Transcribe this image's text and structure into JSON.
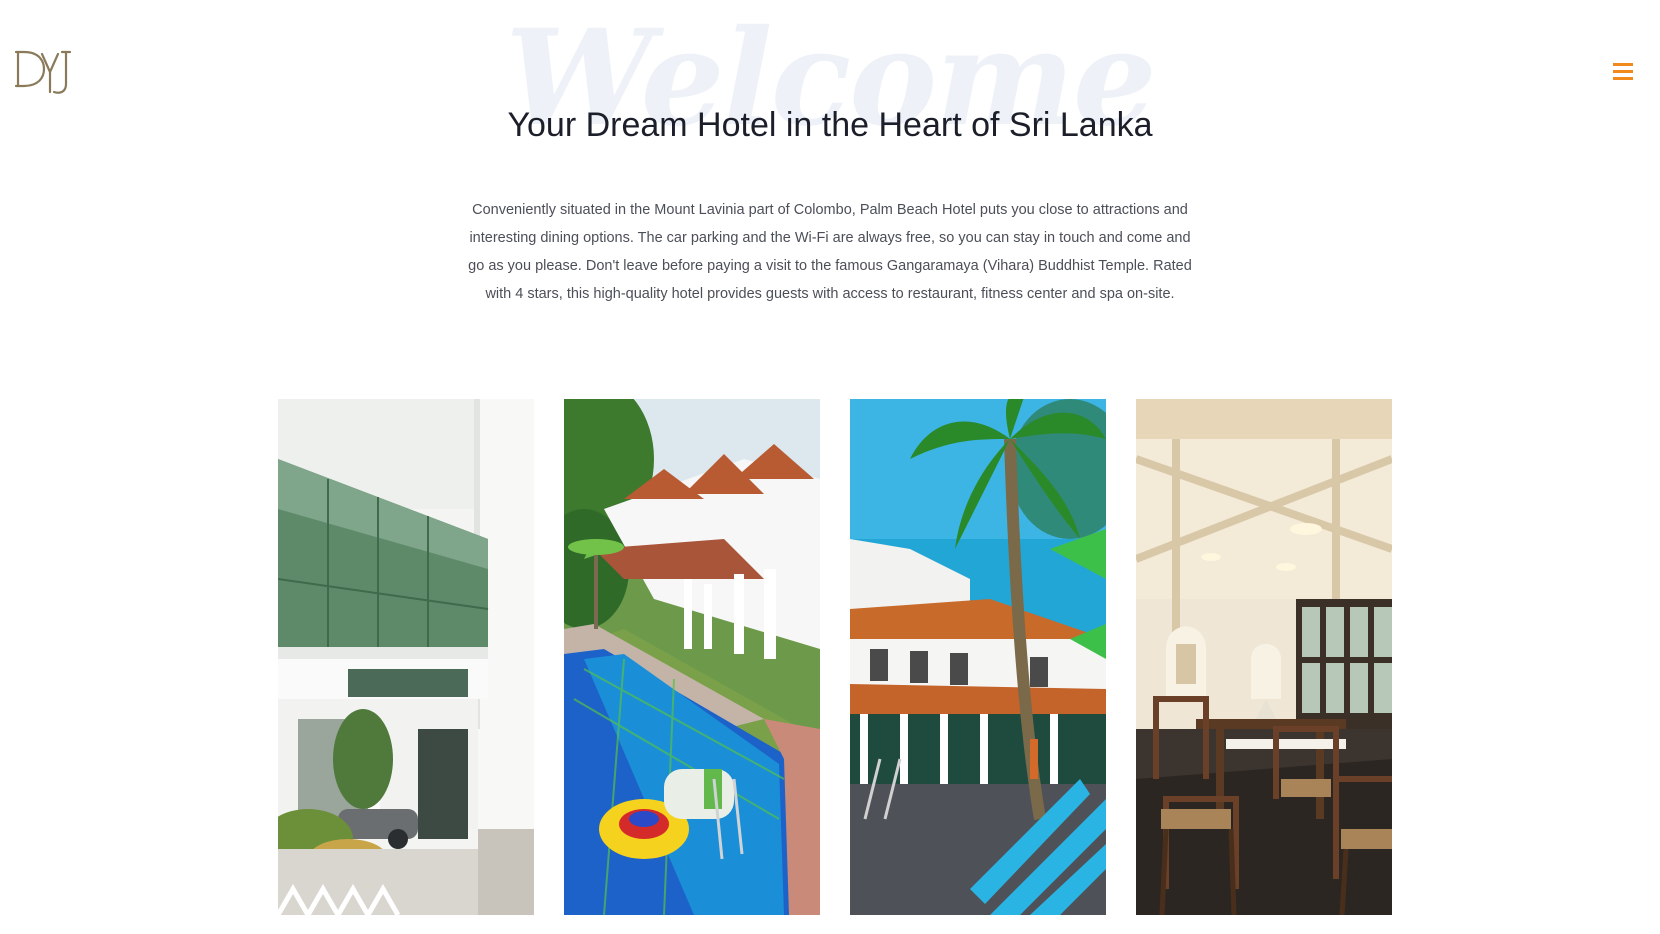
{
  "header": {
    "logo_text": "DYJ",
    "menu_icon": "hamburger-menu-icon",
    "accent_color": "#f08a1c",
    "logo_color": "#8a7a5a"
  },
  "hero": {
    "background_word": "Welcome",
    "title": "Your Dream Hotel in the Heart of Sri Lanka",
    "intro": "Conveniently situated in the Mount Lavinia part of Colombo, Palm Beach Hotel puts you close to attractions and interesting dining options. The car parking and the Wi-Fi are always free, so you can stay in touch and come and go as you please. Don't leave before paying a visit to the famous Gangaramaya (Vihara) Buddhist Temple. Rated with 4 stars, this high-quality hotel provides guests with access to restaurant, fitness center and spa on-site."
  }
}
